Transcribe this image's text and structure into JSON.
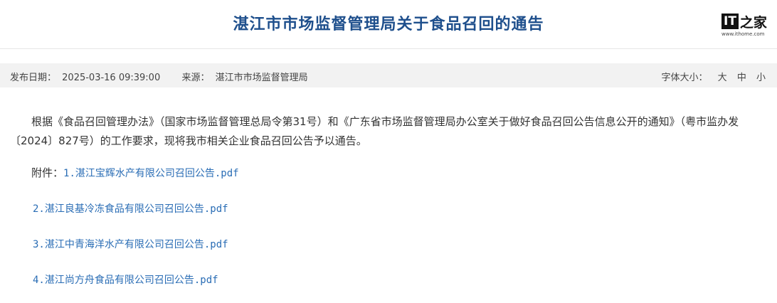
{
  "header": {
    "title": "湛江市市场监督管理局关于食品召回的通告",
    "logo_text": "IT之家",
    "logo_url": "www.ithome.com"
  },
  "meta": {
    "date_label": "发布日期：",
    "date_value": "2025-03-16 09:39:00",
    "source_label": "来源：",
    "source_value": "湛江市市场监督管理局",
    "font_size_label": "字体大小：",
    "font_size_options": [
      "大",
      "中",
      "小"
    ]
  },
  "body": {
    "paragraph": "根据《食品召回管理办法》（国家市场监督管理总局令第31号）和《广东省市场监督管理局办公室关于做好食品召回公告信息公开的通知》（粤市监办发〔2024〕827号）的工作要求，现将我市相关企业食品召回公告予以通告。",
    "attachment_label": "附件：",
    "attachments": [
      "1.湛江宝辉水产有限公司召回公告.pdf",
      "2.湛江良基冷冻食品有限公司召回公告.pdf",
      "3.湛江中青海洋水产有限公司召回公告.pdf",
      "4.湛江尚方舟食品有限公司召回公告.pdf"
    ]
  }
}
